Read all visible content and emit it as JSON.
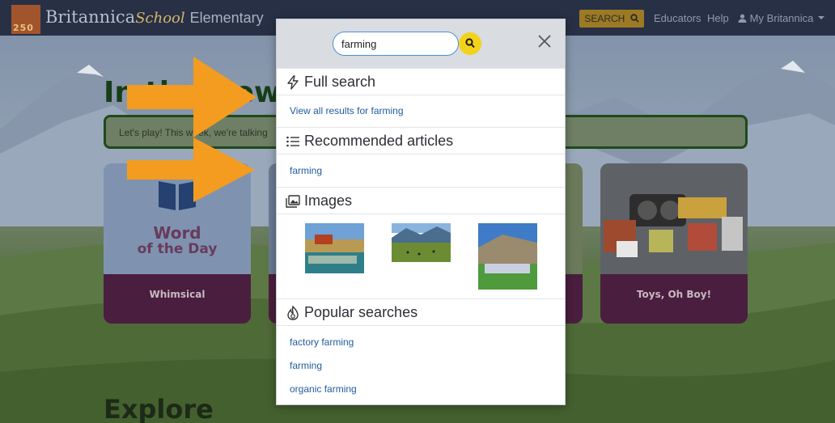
{
  "header": {
    "logo_year": "250",
    "brand_name": "Britannica",
    "brand_school": "School",
    "brand_level": "Elementary",
    "search_button": "SEARCH",
    "nav": [
      "Educators",
      "Help",
      "My Britannica"
    ]
  },
  "page": {
    "news_title": "In the News!",
    "news_text": "Let's play! This week, we're talking",
    "cards": [
      {
        "caption": "Whimsical",
        "art_line1": "Word",
        "art_line2": "of the Day"
      },
      {
        "caption": "Toys, Oh Boy!"
      }
    ],
    "explore_title": "Explore"
  },
  "search": {
    "query": "farming",
    "full_search_heading": "Full search",
    "view_all_link": "View all results for farming",
    "recommended_heading": "Recommended articles",
    "recommended": [
      "farming"
    ],
    "images_heading": "Images",
    "images": [
      "harvest-field-image",
      "valley-pasture-image",
      "hillside-crowd-image"
    ],
    "popular_heading": "Popular searches",
    "popular": [
      "factory farming",
      "farming",
      "organic farming"
    ]
  },
  "colors": {
    "arrow": "#f39c1f",
    "link": "#1f5c9c",
    "search_go": "#f3d21c",
    "topbar": "#283046"
  },
  "icons": [
    "lightning-icon",
    "list-icon",
    "images-icon",
    "fire-icon",
    "magnifier-icon",
    "close-icon",
    "user-icon",
    "caret-down-icon"
  ]
}
